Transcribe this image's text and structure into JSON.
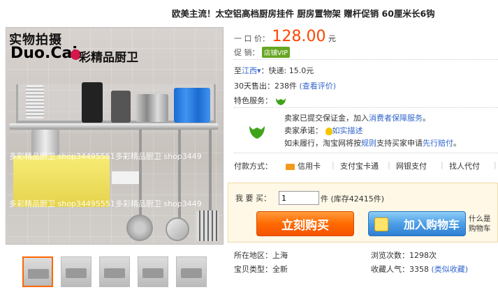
{
  "title": "欧美主流！太空铝高档厨房挂件  厨房置物架  赠杆促销  60厘米长6钩",
  "image": {
    "stamp": "实物拍摄",
    "brand_en": "Duo.Cai",
    "brand_cn": "彩精品厨卫",
    "watermark_1": "多彩精品厨卫  shop34495551多彩精品厨卫  shop3449",
    "watermark_2": "多彩精品厨卫  shop34495551多彩精品厨卫  shop3449"
  },
  "price": {
    "label": "一 口 价：",
    "value": "128.00",
    "unit": "元"
  },
  "promo": {
    "label": "促      销：",
    "badge": "店铺VIP"
  },
  "shipping": {
    "to": "至",
    "city": "江西",
    "arrow": "▾",
    "sep": "：",
    "text": "快递: 15.0元"
  },
  "sales": {
    "text": "30天售出：238件",
    "link": "(查看评价)"
  },
  "special": {
    "label": "特色服务："
  },
  "guarantee": {
    "line1_prefix": "卖家已提交保证金，加入",
    "line1_link": "消费者保障服务",
    "line1_suffix": "。",
    "line2_label": "卖家承诺：",
    "line2_link": "如实描述",
    "line3_prefix": "如未履行，淘宝网将按",
    "line3_link1": "规则",
    "line3_mid": "支持买家申请",
    "line3_link2": "先行赔付",
    "line3_suffix": "。"
  },
  "payment": {
    "label": "付款方式：",
    "options": [
      "信用卡",
      "支付宝卡通",
      "网银支付",
      "找人代付"
    ]
  },
  "buy": {
    "qty_label": "我 要 买：",
    "qty_value": "1",
    "stock": "件  (库存42415件)",
    "buy_now": "立刻购买",
    "add_cart": "加入购物车",
    "whatis_1": "什么是",
    "whatis_2": "购物车"
  },
  "info": {
    "location_label": "所在地区：上海",
    "views": "浏览次数：1298次",
    "type": "宝贝类型：全新",
    "favs": "收藏人气：3358",
    "similar": "(类似收藏)"
  }
}
